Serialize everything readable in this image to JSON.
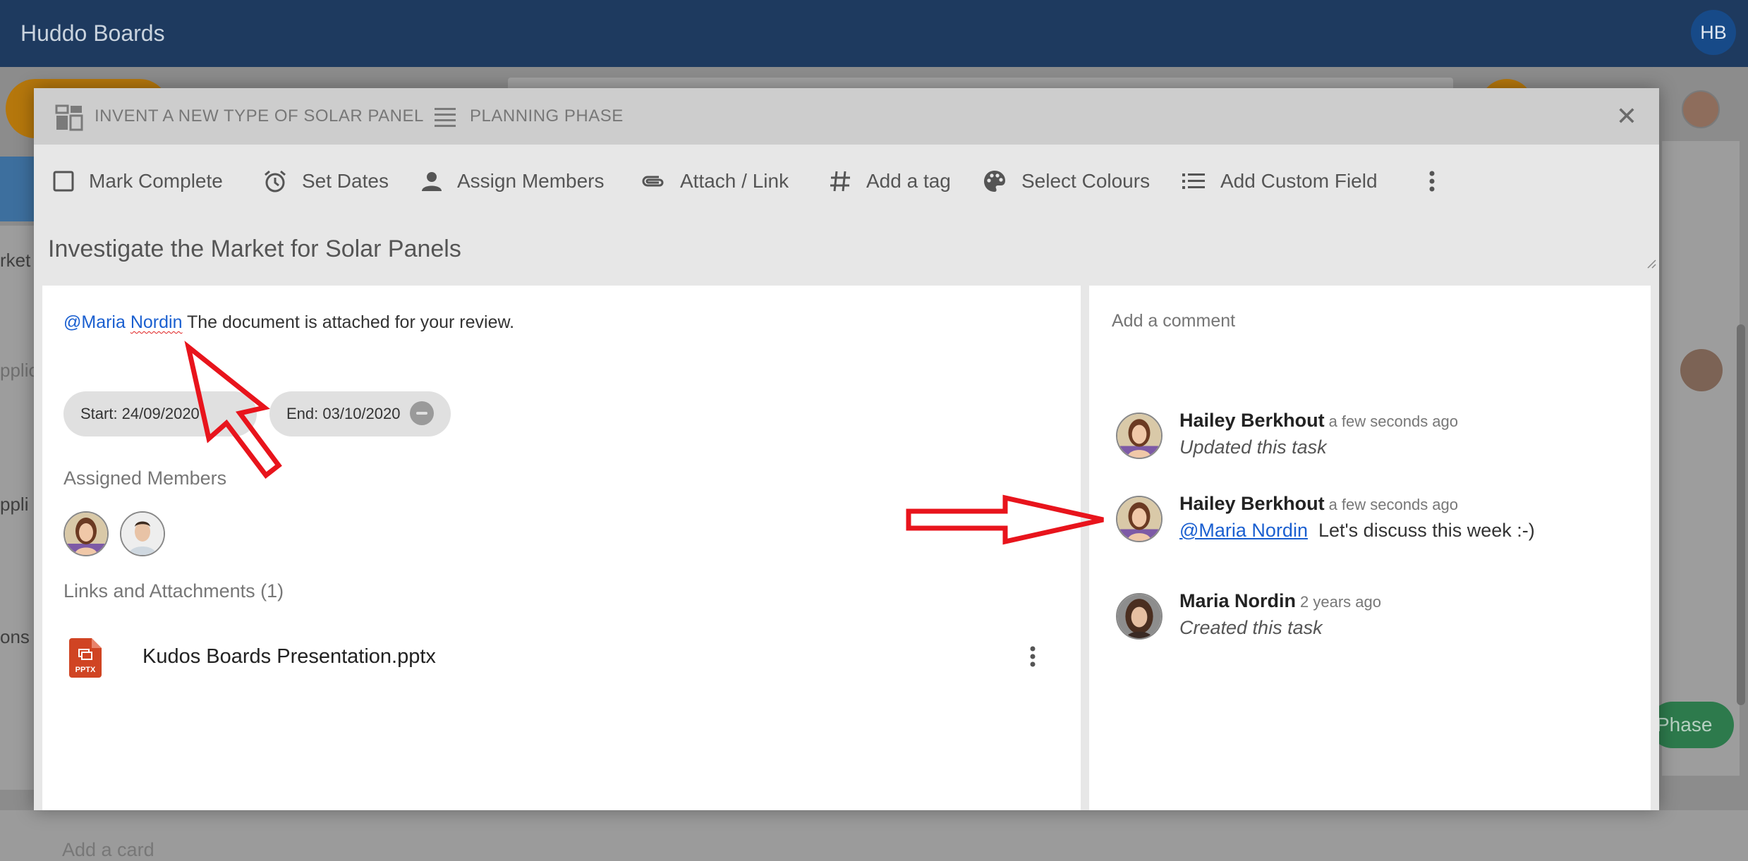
{
  "app": {
    "title": "Huddo Boards",
    "user_initials": "HB"
  },
  "background": {
    "left_cut_texts": [
      "rket",
      "pplic",
      "ppli",
      "ons"
    ],
    "phase_button": "Phase"
  },
  "modal": {
    "breadcrumb": {
      "board": "INVENT A NEW TYPE OF SOLAR PANEL",
      "list": "PLANNING PHASE"
    },
    "toolbar": {
      "mark_complete": "Mark Complete",
      "set_dates": "Set Dates",
      "assign_members": "Assign Members",
      "attach_link": "Attach / Link",
      "add_tag": "Add a tag",
      "select_colours": "Select Colours",
      "add_custom_field": "Add Custom Field"
    },
    "card_title": "Investigate the Market for Solar Panels",
    "description": {
      "mention_first": "@Maria",
      "mention_last": "Nordin",
      "text": " The document is attached for your review."
    },
    "dates": {
      "start": "Start: 24/09/2020",
      "end": "End: 03/10/2020"
    },
    "assigned_members_title": "Assigned Members",
    "links_title": "Links and Attachments (1)",
    "attachment": {
      "name": "Kudos Boards Presentation.pptx",
      "type": "PPTX"
    },
    "add_card": "Add a card",
    "comment_placeholder": "Add a comment",
    "activity": [
      {
        "name": "Hailey Berkhout",
        "time": "a few seconds ago",
        "text": "Updated this task"
      },
      {
        "name": "Hailey Berkhout",
        "time": "a few seconds ago",
        "mention": "@Maria Nordin",
        "comment": "Let's discuss this week :-)"
      },
      {
        "name": "Maria Nordin",
        "time": "2 years ago",
        "text": "Created this task"
      }
    ]
  },
  "colors": {
    "appbar": "#1e3a5f",
    "mention": "#1a5fd0",
    "annotation": "#e8141c",
    "pptx": "#d04423"
  }
}
